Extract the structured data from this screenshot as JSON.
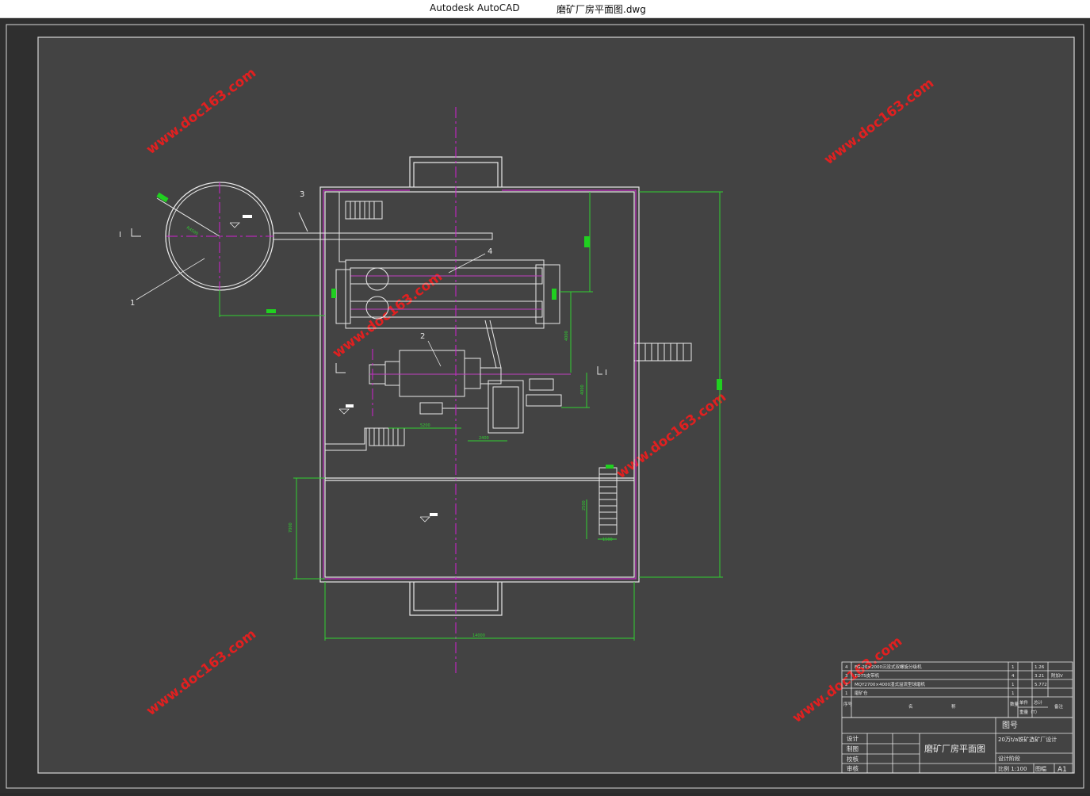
{
  "window": {
    "app_name": "Autodesk AutoCAD",
    "document_name": "磨矿厂房平面图.dwg"
  },
  "drawing": {
    "labels": [
      "1",
      "2",
      "3",
      "4"
    ],
    "section_marker": "I",
    "dims": {
      "width_bottom": "14000",
      "left_dim": "7000",
      "mill_len": "5200",
      "motor_len": "2400",
      "v1": "4000",
      "v2": "4000",
      "stair_w": "1500",
      "stair_h": "2500",
      "radius": "R4500"
    },
    "watermark": "www.doc163.com"
  },
  "parts_table": {
    "rows": [
      {
        "no": "4",
        "name": "FG-20×2000沉没式双螺旋分级机",
        "qty": "1",
        "weight": "1.26",
        "note": ""
      },
      {
        "no": "3",
        "name": "TD75皮带机",
        "qty": "4",
        "weight": "3.21",
        "note": "附加V"
      },
      {
        "no": "2",
        "name": "MQY2700×4000湿式溢流型球磨机",
        "qty": "1",
        "weight": "5.772",
        "note": ""
      },
      {
        "no": "1",
        "name": "磨矿仓",
        "qty": "1",
        "weight": "",
        "note": ""
      }
    ],
    "header": {
      "no": "序号",
      "name_a": "名",
      "name_b": "称",
      "qty": "数量",
      "unit_weight": "单件",
      "total_weight": "总计",
      "weight_unit": "重量（T）",
      "note": "备注"
    }
  },
  "title_block": {
    "drawing_no_label": "图号",
    "title": "磨矿厂房平面图",
    "project": "20万t/a铁矿选矿厂设计",
    "stage": "设计阶段",
    "scale": "比例 1:100",
    "sheet_label": "图幅",
    "sheet_size": "A1",
    "roles": [
      "设计",
      "制图",
      "校核",
      "审核"
    ]
  }
}
